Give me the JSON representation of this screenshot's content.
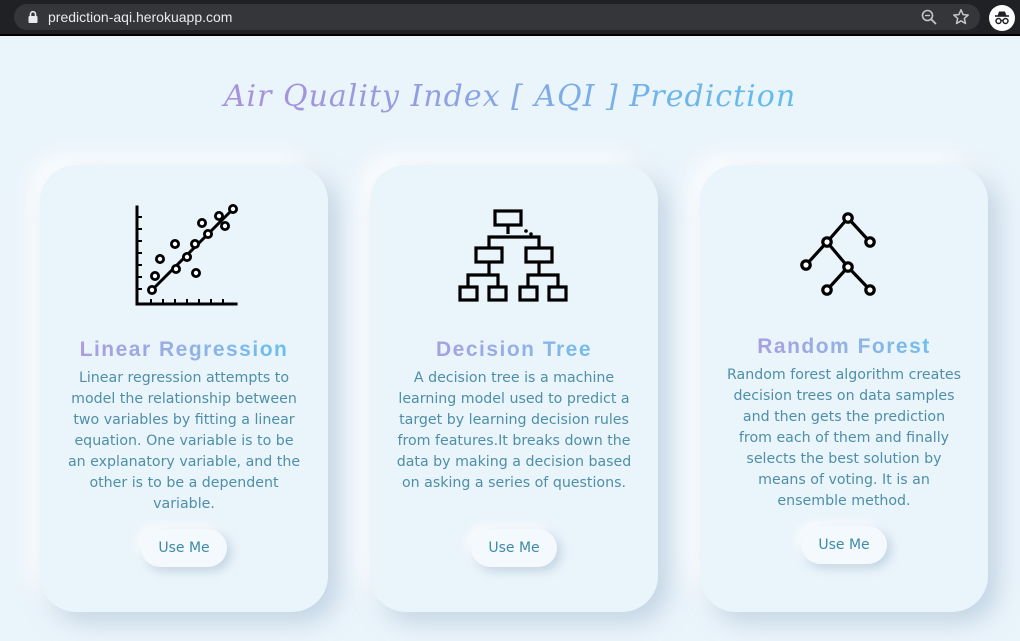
{
  "browser": {
    "url": "prediction-aqi.herokuapp.com",
    "icons": [
      "lock-icon",
      "zoom-icon",
      "bookmark-star-icon",
      "incognito-icon"
    ]
  },
  "page": {
    "title": "Air Quality Index [ AQI ] Prediction"
  },
  "cards": [
    {
      "title": "Linear Regression",
      "description": "Linear regression attempts to model the relationship between two variables by fitting a linear equation. One variable is to be an explanatory variable, and the other is to be a dependent variable.",
      "button": "Use Me",
      "icon": "scatter-regression-icon"
    },
    {
      "title": "Decision Tree",
      "description": "A decision tree is a machine learning model used to predict a target by learning decision rules from features.It breaks down the data by making a decision based on asking a series of questions.",
      "button": "Use Me",
      "icon": "decision-tree-icon"
    },
    {
      "title": "Random Forest",
      "description": "Random forest algorithm creates decision trees on data samples and then gets the prediction from each of them and finally selects the best solution by means of voting. It is an ensemble method.",
      "button": "Use Me",
      "icon": "random-forest-icon"
    }
  ],
  "colors": {
    "background": "#eaf4fb",
    "body_text": "#4e8fa8",
    "gradient_start": "#b695d8",
    "gradient_end": "#4cc8ef"
  }
}
